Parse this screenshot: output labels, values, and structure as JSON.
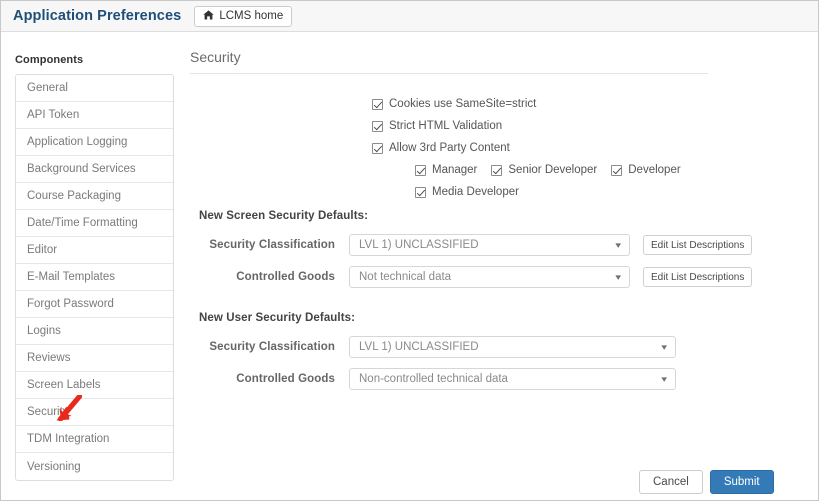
{
  "header": {
    "title": "Application Preferences",
    "home_button": {
      "icon": "home-icon",
      "glyph": "⌂",
      "label": "LCMS home"
    }
  },
  "sidebar": {
    "title": "Components",
    "items": [
      {
        "label": "General"
      },
      {
        "label": "API Token"
      },
      {
        "label": "Application Logging"
      },
      {
        "label": "Background Services"
      },
      {
        "label": "Course Packaging"
      },
      {
        "label": "Date/Time Formatting"
      },
      {
        "label": "Editor"
      },
      {
        "label": "E-Mail Templates"
      },
      {
        "label": "Forgot Password"
      },
      {
        "label": "Logins"
      },
      {
        "label": "Reviews"
      },
      {
        "label": "Screen Labels"
      },
      {
        "label": "Security"
      },
      {
        "label": "TDM Integration"
      },
      {
        "label": "Versioning"
      }
    ],
    "annotation": {
      "name": "red-arrow-annotation",
      "target": "Security",
      "color": "#e8291c"
    }
  },
  "main": {
    "heading": "Security",
    "checkboxes": [
      {
        "label": "Cookies use SameSite=strict",
        "checked": true
      },
      {
        "label": "Strict HTML Validation",
        "checked": true
      },
      {
        "label": "Allow 3rd Party Content",
        "checked": true
      }
    ],
    "roles_row1": [
      {
        "label": "Manager",
        "checked": true
      },
      {
        "label": "Senior Developer",
        "checked": true
      },
      {
        "label": "Developer",
        "checked": true
      }
    ],
    "roles_row2": [
      {
        "label": "Media Developer",
        "checked": true
      }
    ],
    "screen_defaults": {
      "title": "New Screen Security Defaults:",
      "rows": [
        {
          "label": "Security Classification",
          "value": "LVL 1) UNCLASSIFIED",
          "edit_label": "Edit List Descriptions"
        },
        {
          "label": "Controlled Goods",
          "value": "Not technical data",
          "edit_label": "Edit List Descriptions"
        }
      ]
    },
    "user_defaults": {
      "title": "New User Security Defaults:",
      "rows": [
        {
          "label": "Security Classification",
          "value": "LVL 1) UNCLASSIFIED"
        },
        {
          "label": "Controlled Goods",
          "value": "Non-controlled technical data"
        }
      ]
    },
    "footer": {
      "cancel_label": "Cancel",
      "submit_label": "Submit",
      "submit_color": "#337ab7"
    }
  }
}
